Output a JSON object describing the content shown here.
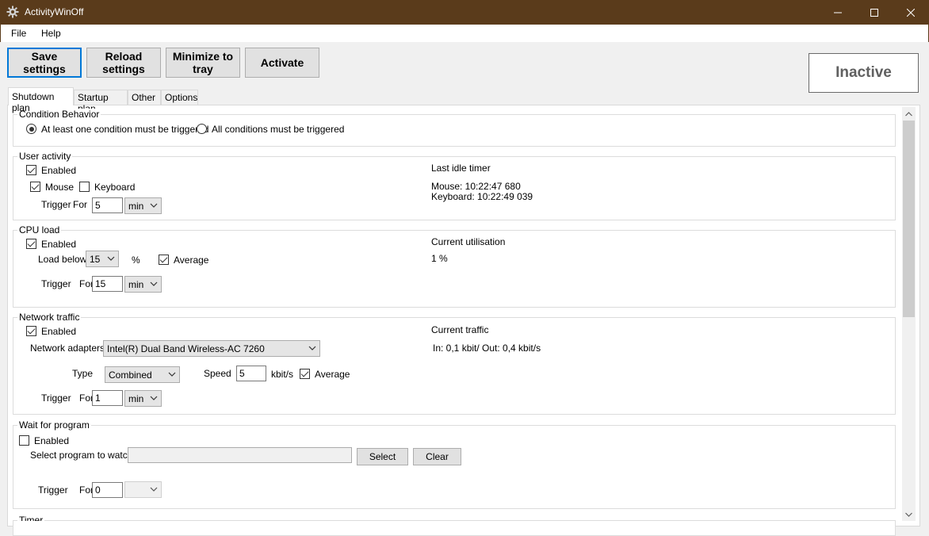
{
  "window": {
    "title": "ActivityWinOff",
    "icon": "gear-icon"
  },
  "menu": {
    "file": "File",
    "help": "Help"
  },
  "toolbar": {
    "save": "Save\nsettings",
    "reload": "Reload\nsettings",
    "minimize": "Minimize to\ntray",
    "activate": "Activate",
    "status": "Inactive"
  },
  "tabs": [
    "Shutdown plan",
    "Startup plan",
    "Other",
    "Options"
  ],
  "condition_behavior": {
    "legend": "Condition Behavior",
    "option_one": "At least one condition must be triggered",
    "option_all": "All conditions must be triggered",
    "selected": "option_one"
  },
  "user_activity": {
    "legend": "User activity",
    "enabled_label": "Enabled",
    "enabled": true,
    "mouse_label": "Mouse",
    "mouse": true,
    "keyboard_label": "Keyboard",
    "keyboard": false,
    "trigger_label": "Trigger",
    "for_label": "For",
    "for_value": "5",
    "unit": "min",
    "info_title": "Last idle timer",
    "mouse_timer": "Mouse: 10:22:47 680",
    "keyboard_timer": "Keyboard: 10:22:49 039"
  },
  "cpu_load": {
    "legend": "CPU load",
    "enabled_label": "Enabled",
    "enabled": true,
    "load_below_label": "Load below",
    "load_value": "15",
    "percent_label": "%",
    "average_label": "Average",
    "average": true,
    "trigger_label": "Trigger",
    "for_label": "For",
    "for_value": "15",
    "unit": "min",
    "info_title": "Current utilisation",
    "info_value": "1 %"
  },
  "network_traffic": {
    "legend": "Network traffic",
    "enabled_label": "Enabled",
    "enabled": true,
    "adapters_label": "Network adapters",
    "adapter_value": "Intel(R) Dual Band Wireless-AC 7260",
    "type_label": "Type",
    "type_value": "Combined",
    "speed_label": "Speed",
    "speed_value": "5",
    "speed_unit": "kbit/s",
    "average_label": "Average",
    "average": true,
    "trigger_label": "Trigger",
    "for_label": "For",
    "for_value": "1",
    "unit": "min",
    "info_title": "Current traffic",
    "info_value": "In: 0,1 kbit/ Out: 0,4 kbit/s"
  },
  "wait_for_program": {
    "legend": "Wait for program",
    "enabled_label": "Enabled",
    "enabled": false,
    "select_label": "Select program to watch",
    "program_path": "",
    "select_button": "Select",
    "clear_button": "Clear",
    "trigger_label": "Trigger",
    "for_label": "For",
    "for_value": "0",
    "unit": ""
  },
  "timer": {
    "legend": "Timer"
  },
  "colors": {
    "titlebar": "#5a3b1b",
    "focus": "#0078d7",
    "status_text": "#606060"
  }
}
